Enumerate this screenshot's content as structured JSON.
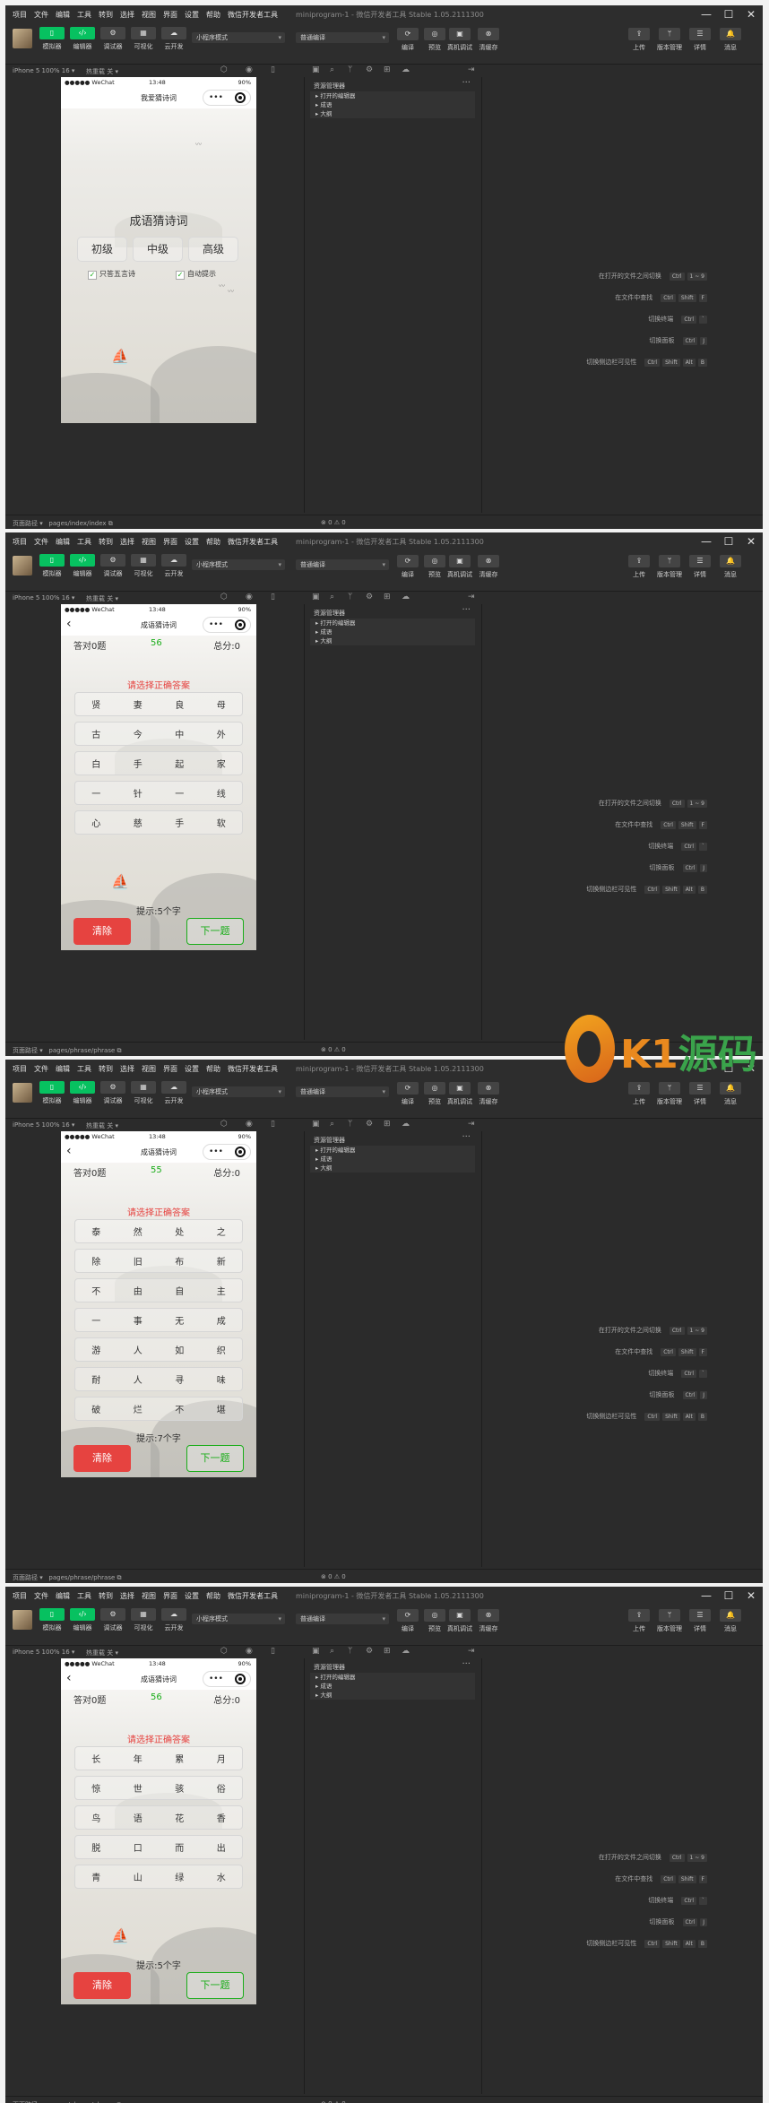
{
  "menu": [
    "项目",
    "文件",
    "编辑",
    "工具",
    "转到",
    "选择",
    "视图",
    "界面",
    "设置",
    "帮助",
    "微信开发者工具"
  ],
  "window_title": "miniprogram-1 - 微信开发者工具 Stable 1.05.2111300",
  "toolbar": {
    "left": [
      {
        "label": "模拟器",
        "icon": "phone-icon",
        "active": true
      },
      {
        "label": "编辑器",
        "icon": "code-icon",
        "active": true
      },
      {
        "label": "调试器",
        "icon": "debug-icon",
        "active": false
      },
      {
        "label": "可视化",
        "icon": "layout-icon",
        "active": false
      },
      {
        "label": "云开发",
        "icon": "cloud-icon",
        "active": false
      }
    ],
    "mode_select": "小程序模式",
    "compile_select": "普通编译",
    "mid": [
      "编译",
      "预览",
      "真机调试",
      "清缓存"
    ],
    "right": [
      "上传",
      "版本管理",
      "详情",
      "消息"
    ]
  },
  "subbar": {
    "device": "iPhone 5 100% 16 ▾",
    "hot_reload": "热重载 关 ▾"
  },
  "explorer": {
    "header": "资源管理器",
    "items": [
      "▸ 打开的编辑器",
      "▸ 成语",
      "▸ 大纲"
    ]
  },
  "shortcuts": [
    {
      "label": "在打开的文件之间切换",
      "keys": [
        "Ctrl",
        "1 ~ 9"
      ]
    },
    {
      "label": "在文件中查找",
      "keys": [
        "Ctrl",
        "Shift",
        "F"
      ]
    },
    {
      "label": "切换终端",
      "keys": [
        "Ctrl",
        "`"
      ]
    },
    {
      "label": "切换面板",
      "keys": [
        "Ctrl",
        "J"
      ]
    },
    {
      "label": "切换侧边栏可见性",
      "keys": [
        "Ctrl",
        "Shift",
        "Alt",
        "B"
      ]
    }
  ],
  "statusbar": {
    "errors": "⊗ 0 ⚠ 0"
  },
  "phone_status": {
    "carrier": "●●●●● WeChat",
    "time": "13:48",
    "battery": "90%"
  },
  "frames": [
    {
      "page_type": "home",
      "path": "pages/index/index",
      "nav_title": "我爱猜诗词",
      "home": {
        "title": "成语猜诗词",
        "levels": [
          "初级",
          "中级",
          "高级"
        ],
        "options": [
          "只答五言诗",
          "自动提示"
        ]
      }
    },
    {
      "page_type": "quiz",
      "path": "pages/phrase/phrase",
      "nav_title": "成语猜诗词",
      "score_left": "答对0题",
      "timer": "56",
      "score_right": "总分:0",
      "prompt": "请选择正确答案",
      "grid": [
        [
          "贤",
          "妻",
          "良",
          "母"
        ],
        [
          "古",
          "今",
          "中",
          "外"
        ],
        [
          "白",
          "手",
          "起",
          "家"
        ],
        [
          "一",
          "针",
          "一",
          "线"
        ],
        [
          "心",
          "慈",
          "手",
          "软"
        ]
      ],
      "hint": "提示:5个字",
      "clear": "清除",
      "next": "下一题"
    },
    {
      "page_type": "quiz",
      "path": "pages/phrase/phrase",
      "nav_title": "成语猜诗词",
      "score_left": "答对0题",
      "timer": "55",
      "score_right": "总分:0",
      "prompt": "请选择正确答案",
      "grid": [
        [
          "泰",
          "然",
          "处",
          "之"
        ],
        [
          "除",
          "旧",
          "布",
          "新"
        ],
        [
          "不",
          "由",
          "自",
          "主"
        ],
        [
          "一",
          "事",
          "无",
          "成"
        ],
        [
          "游",
          "人",
          "如",
          "织"
        ],
        [
          "耐",
          "人",
          "寻",
          "味"
        ],
        [
          "破",
          "烂",
          "不",
          "堪"
        ]
      ],
      "hint": "提示:7个字",
      "clear": "清除",
      "next": "下一题"
    },
    {
      "page_type": "quiz",
      "path": "pages/phrase/phrase",
      "nav_title": "成语猜诗词",
      "score_left": "答对0题",
      "timer": "56",
      "score_right": "总分:0",
      "prompt": "请选择正确答案",
      "grid": [
        [
          "长",
          "年",
          "累",
          "月"
        ],
        [
          "惊",
          "世",
          "骇",
          "俗"
        ],
        [
          "鸟",
          "语",
          "花",
          "香"
        ],
        [
          "脱",
          "口",
          "而",
          "出"
        ],
        [
          "青",
          "山",
          "绿",
          "水"
        ]
      ],
      "hint": "提示:5个字",
      "clear": "清除",
      "next": "下一题"
    }
  ],
  "watermark": {
    "text_a": "K1",
    "text_b": "源码"
  },
  "colors": {
    "accent_green": "#07c160",
    "red": "#e64340",
    "success_green": "#1aad19",
    "ide_bg": "#2b2b2b"
  }
}
